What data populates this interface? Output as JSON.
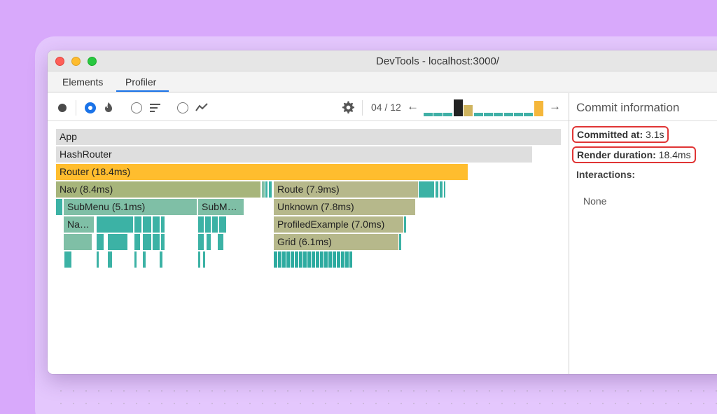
{
  "window": {
    "title": "DevTools - localhost:3000/"
  },
  "tabs": {
    "elements": "Elements",
    "profiler": "Profiler"
  },
  "toolbar": {
    "commit_index": "04 / 12",
    "prev_arrow": "←",
    "next_arrow": "→"
  },
  "side_panel": {
    "title": "Commit information",
    "committed_at_label": "Committed at:",
    "committed_at_value": " 3.1s",
    "render_duration_label": "Render duration:",
    "render_duration_value": " 18.4ms",
    "interactions_label": "Interactions:",
    "interactions_value": "None"
  },
  "flamegraph": {
    "app": "App",
    "hash_router": "HashRouter",
    "router": "Router (18.4ms)",
    "nav": "Nav (8.4ms)",
    "route": "Route (7.9ms)",
    "submenu": "SubMenu (5.1ms)",
    "submenu_short": "SubM…",
    "unknown": "Unknown (7.8ms)",
    "nav_short": "Na…",
    "profiled_example": "ProfiledExample (7.0ms)",
    "grid": "Grid (6.1ms)"
  },
  "colors": {
    "accent": "#1a73e8",
    "highlight_box": "#e03535",
    "router_bar": "#ffbd2e",
    "teal": "#3cb2a5"
  }
}
